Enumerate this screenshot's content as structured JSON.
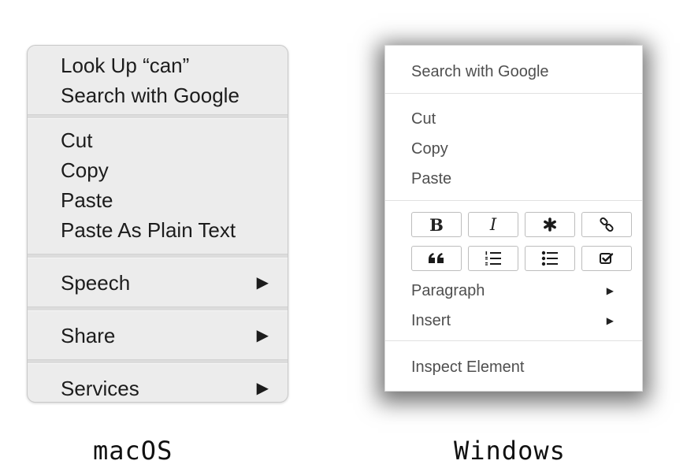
{
  "mac": {
    "os_label": "macOS",
    "sections": [
      {
        "items": [
          {
            "label": "Look Up “can”"
          },
          {
            "label": "Search with Google"
          }
        ]
      },
      {
        "items": [
          {
            "label": "Cut"
          },
          {
            "label": "Copy"
          },
          {
            "label": "Paste"
          },
          {
            "label": "Paste As Plain Text"
          }
        ]
      },
      {
        "items": [
          {
            "label": "Speech",
            "icon": "submenu-arrow-icon"
          }
        ]
      },
      {
        "items": [
          {
            "label": "Share",
            "icon": "submenu-arrow-icon"
          }
        ]
      },
      {
        "items": [
          {
            "label": "Services",
            "icon": "submenu-arrow-icon"
          }
        ]
      }
    ],
    "arrow_glyph": "▶"
  },
  "windows": {
    "os_label": "Windows",
    "search_label": "Search with Google",
    "cut_label": "Cut",
    "copy_label": "Copy",
    "paste_label": "Paste",
    "format_buttons": [
      {
        "name": "bold-button",
        "icon": "bold-icon",
        "label": "B"
      },
      {
        "name": "italic-button",
        "icon": "italic-icon",
        "label": "I"
      },
      {
        "name": "asterisk-button",
        "icon": "asterisk-icon"
      },
      {
        "name": "link-button",
        "icon": "link-icon"
      },
      {
        "name": "quote-button",
        "icon": "quote-icon"
      },
      {
        "name": "numbered-list-button",
        "icon": "numbered-list-icon"
      },
      {
        "name": "bullet-list-button",
        "icon": "bullet-list-icon"
      },
      {
        "name": "checkbox-button",
        "icon": "checkbox-icon"
      }
    ],
    "paragraph_label": "Paragraph",
    "insert_label": "Insert",
    "inspect_label": "Inspect Element",
    "arrow_glyph": "▶"
  }
}
